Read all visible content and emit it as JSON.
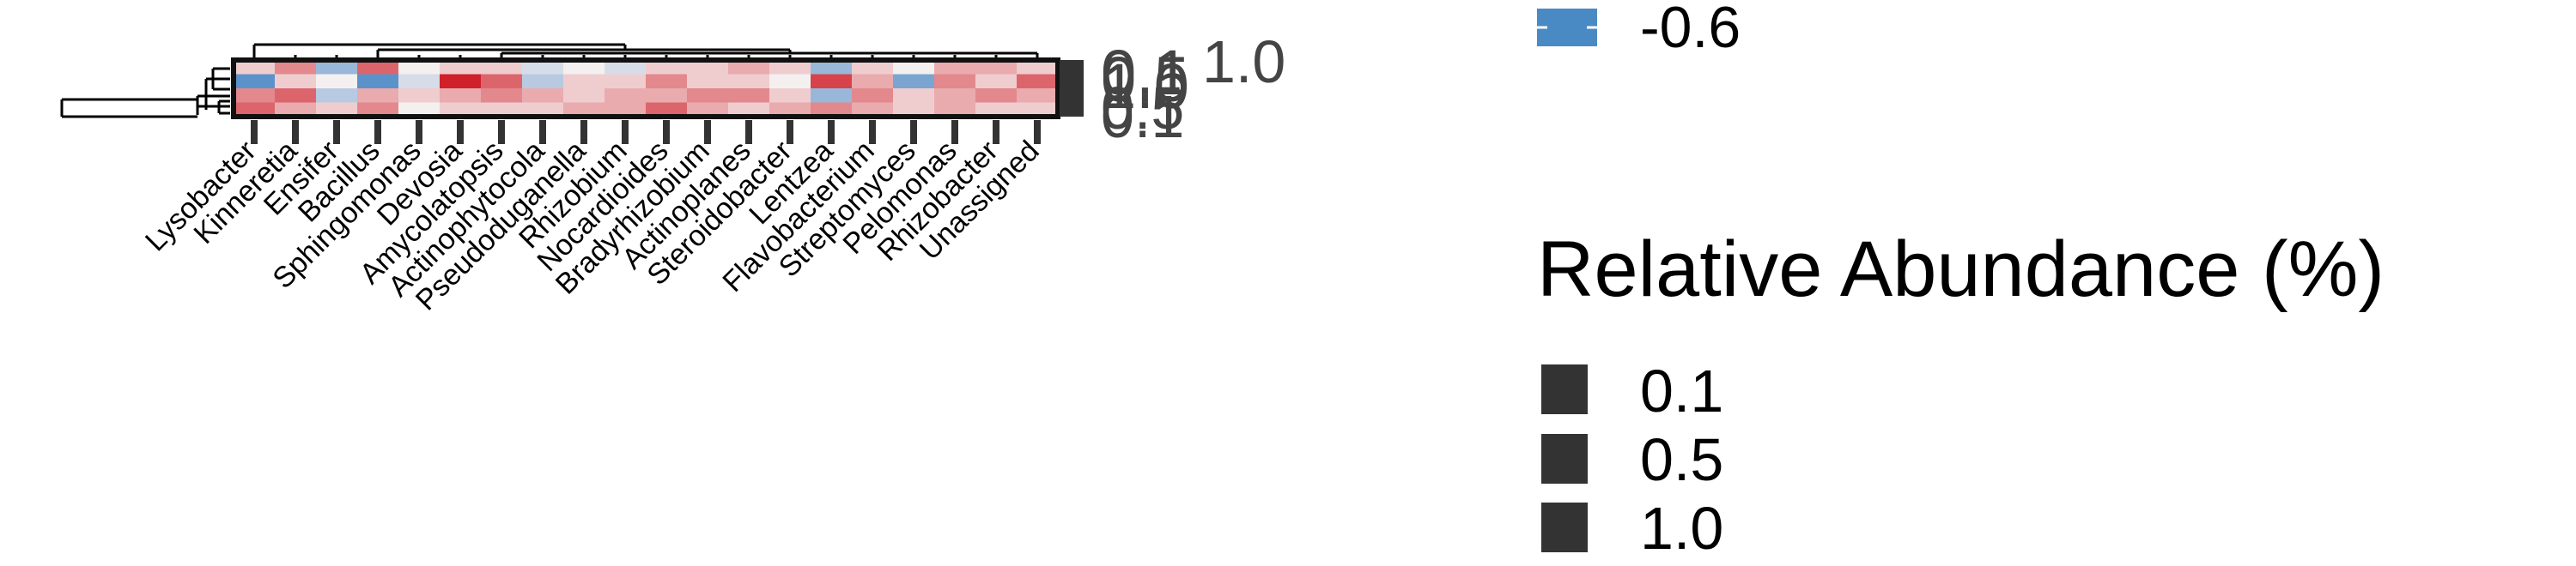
{
  "chart_data": {
    "type": "heatmap",
    "x": [
      "Lysobacter",
      "Kinneretia",
      "Ensifer",
      "Bacillus",
      "Sphingomonas",
      "Devosia",
      "Amycolatopsis",
      "Actinophytocola",
      "Pseudoduganella",
      "Rhizobium",
      "Nocardioides",
      "Bradyrhizobium",
      "Actinoplanes",
      "Steroidobacter",
      "Lentzea",
      "Flavobacterium",
      "Streptomyces",
      "Pelomonas",
      "Rhizobacter",
      "Unassigned"
    ],
    "z": [
      [
        0.1,
        0.3,
        -0.3,
        0.4,
        0.0,
        0.1,
        0.1,
        -0.1,
        0.0,
        -0.1,
        0.1,
        0.1,
        0.2,
        0.1,
        -0.3,
        0.1,
        0.0,
        0.2,
        0.2,
        0.1
      ],
      [
        -0.5,
        0.1,
        0.0,
        -0.5,
        -0.1,
        0.6,
        0.4,
        -0.2,
        0.1,
        0.1,
        0.3,
        0.1,
        0.1,
        0.0,
        0.5,
        0.2,
        -0.4,
        0.3,
        0.1,
        0.4
      ],
      [
        0.3,
        0.4,
        -0.2,
        0.2,
        0.1,
        0.2,
        0.3,
        0.2,
        0.1,
        0.2,
        0.2,
        0.3,
        0.3,
        0.1,
        -0.3,
        0.3,
        0.1,
        0.2,
        0.3,
        0.2
      ],
      [
        0.4,
        0.2,
        0.1,
        0.3,
        0.0,
        0.1,
        0.1,
        0.1,
        0.2,
        0.2,
        0.4,
        0.2,
        0.1,
        0.2,
        0.3,
        0.2,
        0.1,
        0.2,
        0.1,
        0.1
      ]
    ],
    "row_annotation_labels": [
      "0.1",
      "0.5",
      "1.0"
    ],
    "color_legend": {
      "label": "-0.6",
      "color": "#4a8ac4"
    },
    "size_legend": {
      "title": "Relative Abundance (%)",
      "labels": [
        "0.1",
        "0.5",
        "1.0"
      ]
    },
    "colors": {
      "negative": "#3d7fc2",
      "positive": "#d0202a",
      "neutral": "#f5f0f0",
      "annotation": "#333333",
      "ink": "#000000"
    }
  }
}
